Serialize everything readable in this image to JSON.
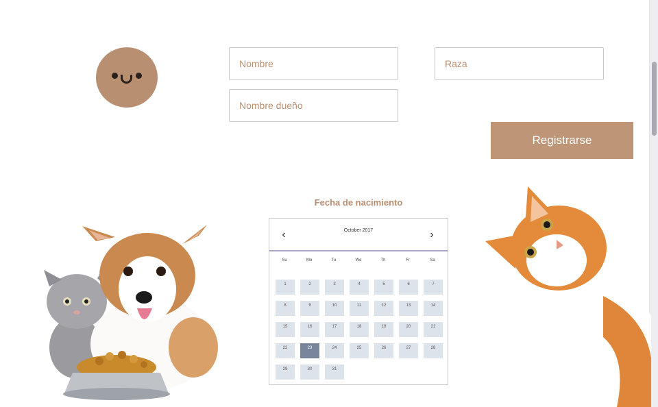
{
  "form": {
    "nombre_placeholder": "Nombre",
    "raza_placeholder": "Raza",
    "dueno_placeholder": "Nombre dueño",
    "submit_label": "Registrarse"
  },
  "calendar": {
    "title": "Fecha de nacimiento",
    "month_label": "October 2017",
    "prev_icon": "‹",
    "next_icon": "›",
    "weekdays": [
      "Su",
      "Mo",
      "Tu",
      "We",
      "Th",
      "Fr",
      "Sa"
    ],
    "days": [
      "1",
      "2",
      "3",
      "4",
      "5",
      "6",
      "7",
      "8",
      "9",
      "10",
      "11",
      "12",
      "13",
      "14",
      "15",
      "16",
      "17",
      "18",
      "19",
      "20",
      "21",
      "22",
      "23",
      "24",
      "25",
      "26",
      "27",
      "28",
      "29",
      "30",
      "31"
    ],
    "selected_day": "23"
  },
  "colors": {
    "accent": "#be9677",
    "avatar": "#b98f72",
    "day_cell": "#dde3ea",
    "day_selected": "#79859b"
  },
  "icons": {
    "avatar": "smiley-face-icon",
    "prev": "chevron-left-icon",
    "next": "chevron-right-icon"
  }
}
